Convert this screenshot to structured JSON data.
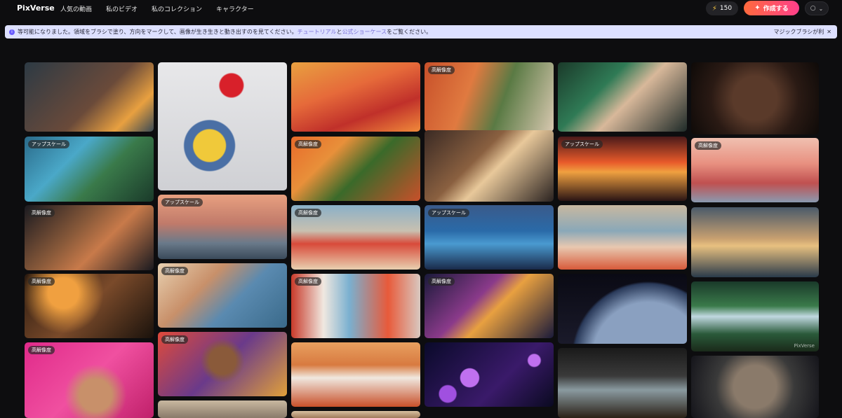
{
  "header": {
    "logo": "PixVerse",
    "nav": [
      "人気の動画",
      "私のビデオ",
      "私のコレクション",
      "キャラクター"
    ],
    "credits": "150",
    "create_label": "作成する"
  },
  "banner": {
    "text_before": "等可能になりました。領域をブラシで塗り、方向をマークして、画像が生き生きと動き出すのを見てください。",
    "link1": "チュートリアル",
    "and": "と",
    "link2": "公式ショーケース",
    "text_after": "をご覧ください。",
    "right_label": "マジックブラシが利"
  },
  "badges": {
    "upscale": "アップスケール",
    "hq": "高解像度"
  },
  "watermark": "PixVerse",
  "cards": [
    {
      "id": "c1",
      "desc": "soldiers-sea",
      "badge": "",
      "bg": "linear-gradient(135deg,#2d3a44 0%,#6a4a3a 55%,#e8a040 80%,#3a4a55 100%)"
    },
    {
      "id": "c2",
      "desc": "minion-balloon",
      "badge": "",
      "bg": "radial-gradient(circle at 40% 65%,#f0c93a 0 14%,#4a6fa5 15% 22%,transparent 23%), radial-gradient(circle at 57% 18%,#d8202a 0 9%,transparent 10%), linear-gradient(180deg,#e8e8ea,#cfd0d4)"
    },
    {
      "id": "c3",
      "desc": "desert-red",
      "badge": "",
      "bg": "linear-gradient(160deg,#e8a040 0%,#e66a3a 40%,#c0302a 70%,#f08a3a 100%)"
    },
    {
      "id": "c4",
      "desc": "alley-city",
      "badge": "hq",
      "bg": "linear-gradient(110deg,#c8502a 0%,#e07a40 35%,#5a7a44 60%,#d8c8b0 100%)"
    },
    {
      "id": "c5",
      "desc": "anime-girl-goggles",
      "badge": "",
      "bg": "linear-gradient(135deg,#1b3a2a 0%,#2f7a55 35%,#d8b89a 55%,#1e2a28 100%)"
    },
    {
      "id": "c6",
      "desc": "vault-door-woman",
      "badge": "",
      "bg": "radial-gradient(circle at 50% 50%,#5a3a2a 0 30%,#2a1a14 60%,#0e0a08 100%)"
    },
    {
      "id": "c7",
      "desc": "anime-woman-coast",
      "badge": "upscale",
      "bg": "linear-gradient(135deg,#2a6a8a 0%,#4aa8c8 35%,#3a7a4a 60%,#1a3a2a 100%)"
    },
    {
      "id": "c8",
      "desc": "orange-tree-house",
      "badge": "hq",
      "bg": "linear-gradient(135deg,#e86a2a 0%,#e8903a 30%,#3a6a2a 55%,#c8502a 100%)"
    },
    {
      "id": "c9",
      "desc": "couple-street",
      "badge": "",
      "bg": "linear-gradient(135deg,#3a2a24 0%,#8a6040 40%,#e8c89a 55%,#2a2220 100%)"
    },
    {
      "id": "c10",
      "desc": "volcano-sunset",
      "badge": "upscale",
      "bg": "linear-gradient(180deg,#4a1a1a 0%,#e85a2a 40%,#f0a040 55%,#2a1414 100%)"
    },
    {
      "id": "c11",
      "desc": "pink-planet",
      "badge": "hq",
      "bg": "linear-gradient(180deg,#f0c0b0 0%,#e89080 40%,#c05050 70%,#8a9ab0 100%)"
    },
    {
      "id": "c12",
      "desc": "boxers",
      "badge": "hq",
      "bg": "linear-gradient(135deg,#1a1a20 0%,#8a5a3a 40%,#c87a4a 60%,#1a1a20 100%)"
    },
    {
      "id": "c13",
      "desc": "lake-girl",
      "badge": "upscale",
      "bg": "linear-gradient(180deg,#e8a080 0%,#c07a6a 45%,#6a7a8a 75%,#3a4a5a 100%)"
    },
    {
      "id": "c14",
      "desc": "beach-cafe",
      "badge": "hq",
      "bg": "linear-gradient(180deg,#8ab0c8 0%,#c8c0b0 40%,#d84a3a 60%,#e8d0b0 100%)"
    },
    {
      "id": "c15",
      "desc": "ocean-storm",
      "badge": "upscale",
      "bg": "linear-gradient(180deg,#3a5a8a 0%,#2a6aa8 40%,#4a9ad0 60%,#1a2a4a 100%)"
    },
    {
      "id": "c16",
      "desc": "beach-people",
      "badge": "",
      "bg": "linear-gradient(180deg,#c8b8a0 0%,#8aa8b8 40%,#e8c8b0 65%,#d85a3a 100%)"
    },
    {
      "id": "c17",
      "desc": "sunset-boat",
      "badge": "",
      "bg": "linear-gradient(180deg,#4a5a6a 0%,#c8a070 45%,#e8c080 55%,#2a3a4a 100%)"
    },
    {
      "id": "c18",
      "desc": "old-couple-fire",
      "badge": "hq",
      "bg": "radial-gradient(circle at 30% 30%,#f0a040 0 15%,transparent 40%), linear-gradient(135deg,#2a1a10 0%,#7a4a2a 50%,#1a120c 100%)"
    },
    {
      "id": "c19",
      "desc": "coast-house",
      "badge": "hq",
      "bg": "linear-gradient(135deg,#e8d0b0 0%,#c8906a 35%,#5a8ab0 60%,#3a6a8a 100%)"
    },
    {
      "id": "c20",
      "desc": "laundry-wall",
      "badge": "hq",
      "bg": "linear-gradient(90deg,#c83a2a 0%,#f0e8e0 25%,#7ab0d0 45%,#e85a3a 75%,#d8c8c0 100%)"
    },
    {
      "id": "c21",
      "desc": "spaceship",
      "badge": "hq",
      "bg": "linear-gradient(135deg,#1a1a3a 0%,#8a3a8a 40%,#e8a040 55%,#1a1a3a 100%)"
    },
    {
      "id": "c22",
      "desc": "satellite-earth",
      "badge": "",
      "bg": "radial-gradient(circle at 70% 120%,#8aa0c0 0 45%,#2a3a5a 60%,transparent 62%), linear-gradient(180deg,#0a0a14,#1a1a2a)"
    },
    {
      "id": "c23",
      "desc": "waterfall-jungle",
      "badge": "",
      "bg": "linear-gradient(180deg,#1a3a2a 0%,#3a7a4a 35%,#c0d8e0 50%,#2a5a3a 75%,#1a2a1a 100%)"
    },
    {
      "id": "c24",
      "desc": "woman-confetti",
      "badge": "hq",
      "bg": "radial-gradient(circle at 55% 70%,#c8906a 0 18%,transparent 35%), linear-gradient(135deg,#e02a8a 0%,#f050a0 50%,#c0206a 100%)"
    },
    {
      "id": "c25",
      "desc": "woman-confetti-2",
      "badge": "hq",
      "bg": "radial-gradient(circle at 50% 45%,#8a5a3a 0 18%,transparent 30%), linear-gradient(135deg,#e04a3a 0%,#6a3a8a 50%,#e0a03a 100%)"
    },
    {
      "id": "c26",
      "desc": "laundry-house",
      "badge": "",
      "bg": "linear-gradient(180deg,#e8a060 0%,#d87a40 35%,#f0e8e0 55%,#c8502a 100%)"
    },
    {
      "id": "c27",
      "desc": "bubbles-space",
      "badge": "",
      "bg": "radial-gradient(circle at 35% 55%,#c070f0 0 10%,transparent 11%), radial-gradient(circle at 18% 80%,#a050e0 0 7%,transparent 8%), radial-gradient(circle at 85% 28%,#c070f0 0 5%,transparent 6%), linear-gradient(135deg,#0a0a2a 0%,#3a1a6a 60%,#0a0a20 100%)"
    },
    {
      "id": "c28",
      "desc": "glass-water",
      "badge": "",
      "bg": "linear-gradient(180deg,#1a1a1a 0%,#3a3a3a 40%,#8a9aa0 60%,#2a2016 100%)"
    },
    {
      "id": "c29",
      "desc": "old-man-face",
      "badge": "",
      "bg": "radial-gradient(circle at 50% 50%,#8a7a6a 0 30%,#3a3a3a 55%,#14141a 100%)"
    },
    {
      "id": "c30",
      "desc": "coast-bottom",
      "badge": "",
      "bg": "linear-gradient(180deg,#c8b8a0 0%,#8a7a6a 100%)"
    },
    {
      "id": "c31",
      "desc": "col3-bottom",
      "badge": "",
      "bg": "linear-gradient(180deg,#d8c0a0 0%,#a07a5a 100%)"
    }
  ]
}
